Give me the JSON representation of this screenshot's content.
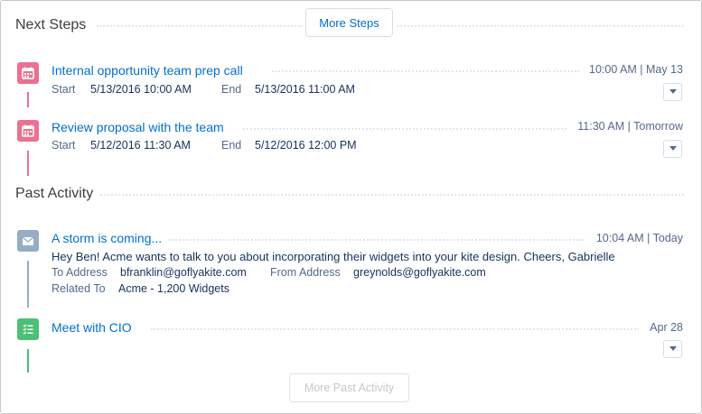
{
  "next_steps": {
    "title": "Next Steps",
    "more_button": "More Steps",
    "items": [
      {
        "title": "Internal opportunity team prep call",
        "time": "10:00 AM | May 13",
        "start_label": "Start",
        "start_value": "5/13/2016 10:00 AM",
        "end_label": "End",
        "end_value": "5/13/2016 11:00 AM",
        "icon": "calendar-icon",
        "color": "#eb7092"
      },
      {
        "title": "Review proposal with the team",
        "time": "11:30 AM | Tomorrow",
        "start_label": "Start",
        "start_value": "5/12/2016 11:30 AM",
        "end_label": "End",
        "end_value": "5/12/2016 12:00 PM",
        "icon": "calendar-icon",
        "color": "#eb7092"
      }
    ]
  },
  "past_activity": {
    "title": "Past Activity",
    "more_button": "More Past Activity",
    "email": {
      "title": "A storm is coming...",
      "time": "10:04 AM | Today",
      "body": "Hey Ben!  Acme wants to talk to you about incorporating their widgets into your kite design.  Cheers, Gabrielle",
      "to_label": "To Address",
      "to_value": "bfranklin@goflyakite.com",
      "from_label": "From Address",
      "from_value": "greynolds@goflyakite.com",
      "related_label": "Related To",
      "related_value": "Acme - 1,200 Widgets",
      "icon": "email-icon",
      "color": "#95aec5"
    },
    "task": {
      "title": "Meet with CIO",
      "time": "Apr 28",
      "icon": "task-icon",
      "color": "#4bc076"
    }
  }
}
